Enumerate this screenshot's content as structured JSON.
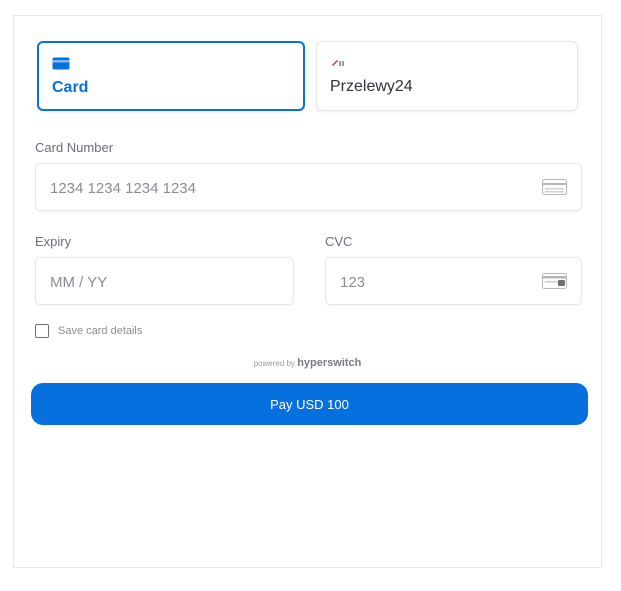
{
  "tabs": [
    {
      "label": "Card",
      "icon": "credit-card-icon",
      "selected": true
    },
    {
      "label": "Przelewy24",
      "icon": "przelewy24-logo-icon",
      "selected": false
    }
  ],
  "card_number": {
    "label": "Card Number",
    "placeholder": "1234 1234 1234 1234",
    "icon": "card-generic-icon"
  },
  "expiry": {
    "label": "Expiry",
    "placeholder": "MM / YY"
  },
  "cvc": {
    "label": "CVC",
    "placeholder": "123",
    "icon": "cvc-card-icon"
  },
  "save_card": {
    "label": "Save card details",
    "checked": false
  },
  "powered_by": {
    "prefix": "powered by",
    "brand": "hyperswitch"
  },
  "pay_button": {
    "label": "Pay USD 100"
  },
  "colors": {
    "accent": "#0570de",
    "border": "#e6e6e6",
    "label": "#6d6e78"
  }
}
